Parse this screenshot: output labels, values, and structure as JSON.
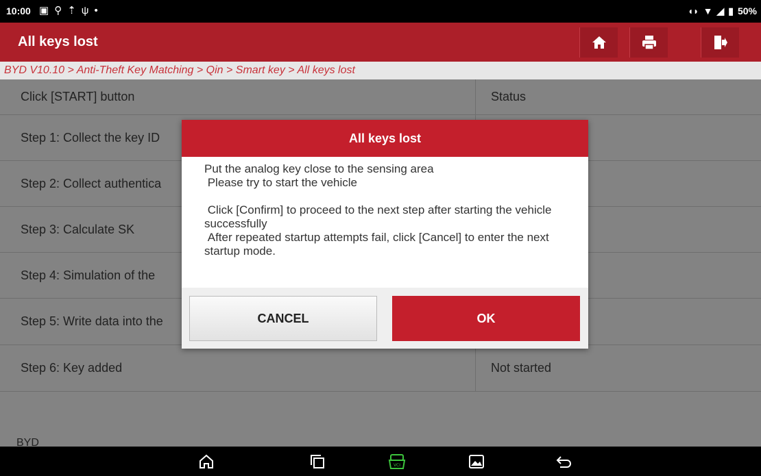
{
  "status_bar": {
    "time": "10:00",
    "battery": "50%",
    "left_icons": [
      "gallery-icon",
      "location-icon",
      "upload-icon",
      "usb-icon",
      "dot-icon"
    ],
    "right_icons": [
      "vibrate-icon",
      "wifi-icon",
      "signal-icon",
      "battery-icon"
    ]
  },
  "header": {
    "title": "All keys lost",
    "buttons": [
      "home-icon",
      "print-icon",
      "exit-icon"
    ]
  },
  "breadcrumb": "BYD V10.10 > Anti-Theft Key Matching > Qin > Smart key > All keys lost",
  "table": {
    "header": {
      "left": "Click [START] button",
      "right": "Status"
    },
    "rows": [
      {
        "left": "Step 1: Collect the key ID",
        "right": ""
      },
      {
        "left": "Step 2: Collect authentica",
        "right": ""
      },
      {
        "left": "Step 3: Calculate SK",
        "right": ""
      },
      {
        "left": "Step 4: Simulation of the",
        "right": ""
      },
      {
        "left": "Step 5: Write data into the",
        "right": ""
      },
      {
        "left": "Step 6: Key added",
        "right": "Not started"
      }
    ]
  },
  "footer_label": "BYD",
  "dialog": {
    "title": "All keys lost",
    "line1": "Put the analog key close to the sensing area",
    "line2": " Please try to start the vehicle",
    "line3": " Click [Confirm] to proceed to the next step after starting the vehicle successfully",
    "line4": " After repeated startup attempts fail, click [Cancel] to enter the next startup mode.",
    "cancel_label": "CANCEL",
    "ok_label": "OK"
  },
  "nav": [
    "home-icon",
    "recents-icon",
    "vci-icon",
    "gallery-icon",
    "back-icon"
  ],
  "colors": {
    "brand_red": "#c41f2c",
    "title_bar": "#ac1f29",
    "vci_green": "#3cc43c"
  }
}
